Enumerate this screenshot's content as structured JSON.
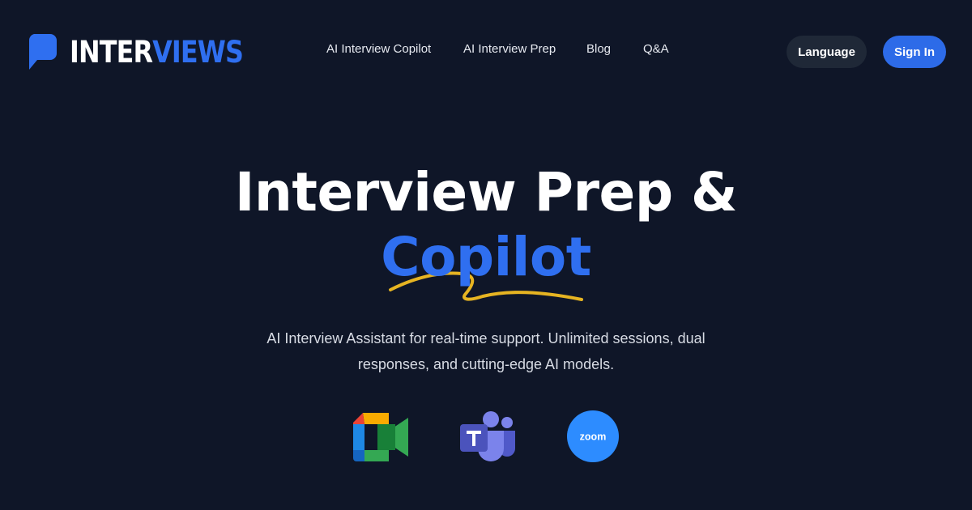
{
  "header": {
    "logo": {
      "text_primary": "INTER",
      "text_accent": "VIEWS",
      "icon": "chat-bubble-icon"
    },
    "nav": [
      {
        "label": "AI Interview Copilot"
      },
      {
        "label": "AI Interview Prep"
      },
      {
        "label": "Blog"
      },
      {
        "label": "Q&A"
      }
    ],
    "language_button": "Language",
    "signin_button": "Sign In"
  },
  "hero": {
    "title_line1": "Interview Prep &",
    "title_highlight": "Copilot",
    "subtitle": "AI Interview Assistant for real-time support. Unlimited sessions, dual responses, and cutting-edge AI models."
  },
  "platforms": [
    {
      "name": "Google Meet",
      "icon": "google-meet-icon"
    },
    {
      "name": "Microsoft Teams",
      "icon": "microsoft-teams-icon"
    },
    {
      "name": "Zoom",
      "icon": "zoom-icon",
      "label": "zoom"
    }
  ],
  "colors": {
    "background": "#0f1628",
    "accent": "#2f6ff0",
    "underline": "#e6b422",
    "language_bg": "#1f2837",
    "signin_bg": "#2d6be8"
  }
}
